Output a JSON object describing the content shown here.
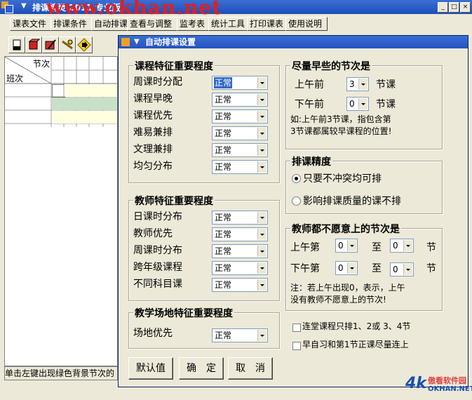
{
  "window": {
    "title": "排课精灵 2011 专业版",
    "watermark": "www.okhan.net"
  },
  "menu": [
    "课表文件",
    "排课条件",
    "自动排课",
    "查看与调整",
    "监考表",
    "统计工具",
    "打印课表",
    "使用说明"
  ],
  "grid": {
    "header_top": "节次",
    "header_left": "班次"
  },
  "status": {
    "text": "单击左键出现绿色背景节次的"
  },
  "dialog": {
    "title": "自动排课设置",
    "course_group": {
      "title": "课程特征重要程度",
      "rows": [
        {
          "label": "周课时分配",
          "value": "正常"
        },
        {
          "label": "课程早晚",
          "value": "正常"
        },
        {
          "label": "课程优先",
          "value": "正常"
        },
        {
          "label": "难易兼排",
          "value": "正常"
        },
        {
          "label": "文理兼排",
          "value": "正常"
        },
        {
          "label": "均匀分布",
          "value": "正常"
        }
      ]
    },
    "teacher_group": {
      "title": "教师特征重要程度",
      "rows": [
        {
          "label": "日课时分布",
          "value": "正常"
        },
        {
          "label": "教师优先",
          "value": "正常"
        },
        {
          "label": "周课时分布",
          "value": "正常"
        },
        {
          "label": "跨年级课程",
          "value": "正常"
        },
        {
          "label": "不同科目课",
          "value": "正常"
        }
      ]
    },
    "venue_group": {
      "title": "教学场地特征重要程度",
      "label": "场地优先",
      "value": "正常"
    },
    "early_group": {
      "title": "尽量早些的节次是",
      "am_label": "上午前",
      "am_value": "3",
      "am_unit": "节课",
      "pm_label": "下午前",
      "pm_value": "0",
      "pm_unit": "节课",
      "note1": "如:上午前3节课，指包含第",
      "note2": "3节课都属较早课程的位置!"
    },
    "precision_group": {
      "title": "排课精度",
      "option1": "只要不冲突均可排",
      "option2": "影响排课质量的课不排"
    },
    "unwanted_group": {
      "title": "教师都不愿意上的节次是",
      "am_label": "上午第",
      "am_from": "0",
      "am_to_label": "至",
      "am_to": "0",
      "am_unit": "节",
      "pm_label": "下午第",
      "pm_from": "0",
      "pm_to_label": "至",
      "pm_to": "0",
      "pm_unit": "节",
      "note1": "注：若上午出现0，表示，上午",
      "note2": "没有教师不愿意上的节次!"
    },
    "check1": "连堂课程只排1、2或 3、4节",
    "check2": "早自习和第1节正课尽量连上",
    "buttons": {
      "default": "默认值",
      "ok": "确　定",
      "cancel": "取　消"
    }
  },
  "logo": {
    "brand": "傲看软件园",
    "site": "OKHAN.NET"
  }
}
